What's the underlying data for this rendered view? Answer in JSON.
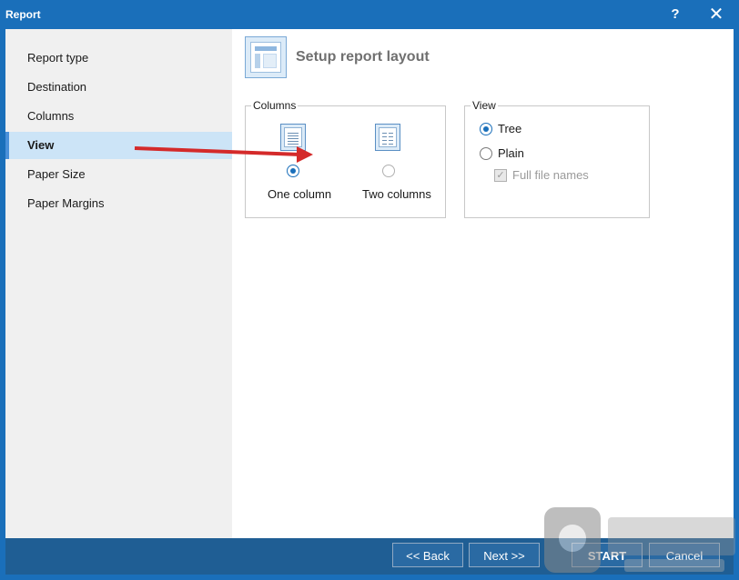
{
  "window": {
    "title": "Report",
    "help_label": "?",
    "close_label": "✕"
  },
  "sidebar": {
    "items": [
      {
        "label": "Report type"
      },
      {
        "label": "Destination"
      },
      {
        "label": "Columns"
      },
      {
        "label": "View"
      },
      {
        "label": "Paper Size"
      },
      {
        "label": "Paper Margins"
      }
    ],
    "active_index": 3
  },
  "header": {
    "title": "Setup report layout"
  },
  "columns_group": {
    "legend": "Columns",
    "options": [
      {
        "label": "One column",
        "selected": true
      },
      {
        "label": "Two columns",
        "selected": false
      }
    ]
  },
  "view_group": {
    "legend": "View",
    "options": [
      {
        "label": "Tree",
        "selected": true
      },
      {
        "label": "Plain",
        "selected": false
      }
    ],
    "full_file_names": {
      "label": "Full file names",
      "checked": true,
      "disabled": true
    }
  },
  "footer": {
    "back_label": "<< Back",
    "next_label": "Next >>",
    "start_label": "START",
    "cancel_label": "Cancel"
  },
  "colors": {
    "accent": "#1a6fba",
    "footer": "#1f5e94",
    "arrow": "#d42a2a"
  }
}
